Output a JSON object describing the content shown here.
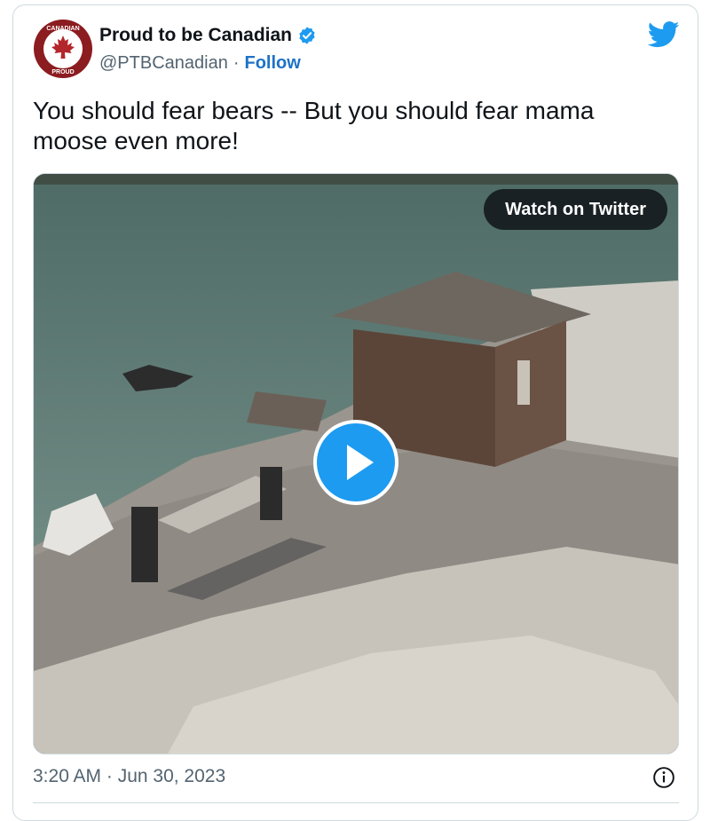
{
  "author": {
    "display_name": "Proud to be Canadian",
    "handle": "@PTBCanadian",
    "separator": "·",
    "follow_label": "Follow",
    "avatar_text": "PROUD CANADIAN",
    "verified_icon": "verified-badge-icon"
  },
  "tweet": {
    "text": "You should fear bears -- But you should fear mama moose even more!"
  },
  "media": {
    "watch_label": "Watch on Twitter",
    "play_icon": "play-icon"
  },
  "footer": {
    "timestamp": "3:20 AM · Jun 30, 2023",
    "info_icon": "info-icon"
  },
  "colors": {
    "brand_blue": "#1d9bf0",
    "follow_blue": "#1d72c7",
    "avatar_red": "#8b1c20",
    "muted_text": "#536471"
  }
}
